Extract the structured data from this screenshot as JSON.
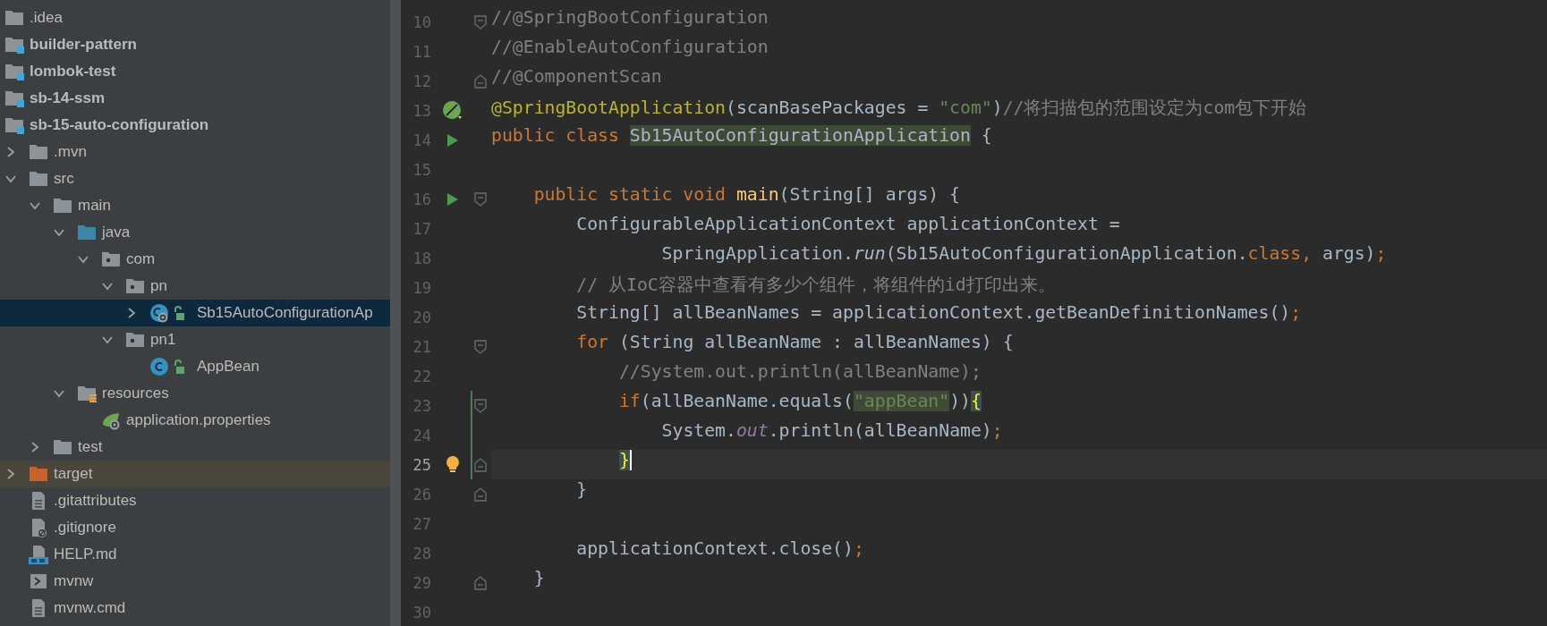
{
  "project_tree": {
    "items": [
      {
        "label": ".idea",
        "kind": "folder",
        "bold": false,
        "selected": false
      },
      {
        "label": "builder-pattern",
        "kind": "module",
        "bold": true,
        "selected": false
      },
      {
        "label": "lombok-test",
        "kind": "module",
        "bold": true,
        "selected": false
      },
      {
        "label": "sb-14-ssm",
        "kind": "module",
        "bold": true,
        "selected": false
      },
      {
        "label": "sb-15-auto-configuration",
        "kind": "module",
        "bold": true,
        "selected": false,
        "children": [
          {
            "label": ".mvn",
            "kind": "folder",
            "bold": false,
            "selected": false,
            "expanded": false
          },
          {
            "label": "src",
            "kind": "folder",
            "bold": false,
            "selected": false,
            "expanded": true,
            "children": [
              {
                "label": "main",
                "kind": "folder",
                "bold": false,
                "selected": false,
                "expanded": true,
                "children": [
                  {
                    "label": "java",
                    "kind": "source-folder",
                    "bold": false,
                    "selected": false,
                    "expanded": true,
                    "children": [
                      {
                        "label": "com",
                        "kind": "package",
                        "bold": false,
                        "selected": false,
                        "expanded": true,
                        "children": [
                          {
                            "label": "pn",
                            "kind": "package",
                            "bold": false,
                            "selected": false,
                            "expanded": true,
                            "children": [
                              {
                                "label": "Sb15AutoConfigurationAp",
                                "kind": "spring-class",
                                "bold": false,
                                "selected": true,
                                "expanded": false
                              }
                            ]
                          },
                          {
                            "label": "pn1",
                            "kind": "package",
                            "bold": false,
                            "selected": false,
                            "expanded": true,
                            "children": [
                              {
                                "label": "AppBean",
                                "kind": "class",
                                "bold": false,
                                "selected": false
                              }
                            ]
                          }
                        ]
                      }
                    ]
                  },
                  {
                    "label": "resources",
                    "kind": "resources",
                    "bold": false,
                    "selected": false,
                    "expanded": true,
                    "children": [
                      {
                        "label": "application.properties",
                        "kind": "properties",
                        "bold": false,
                        "selected": false
                      }
                    ]
                  }
                ]
              },
              {
                "label": "test",
                "kind": "folder",
                "bold": false,
                "selected": false,
                "expanded": false
              }
            ]
          },
          {
            "label": "target",
            "kind": "excluded",
            "bold": false,
            "selected": false,
            "expanded": false
          },
          {
            "label": ".gitattributes",
            "kind": "text-file",
            "bold": false,
            "selected": false
          },
          {
            "label": ".gitignore",
            "kind": "ignore-file",
            "bold": false,
            "selected": false
          },
          {
            "label": "HELP.md",
            "kind": "markdown",
            "bold": false,
            "selected": false
          },
          {
            "label": "mvnw",
            "kind": "script",
            "bold": false,
            "selected": false
          },
          {
            "label": "mvnw.cmd",
            "kind": "text-file",
            "bold": false,
            "selected": false
          }
        ]
      }
    ]
  },
  "editor": {
    "lines": [
      {
        "number": "10",
        "markers": [
          {
            "kind": "fold-start"
          }
        ],
        "changed": false,
        "current": false,
        "segments": [
          {
            "text": "//@SpringBootConfiguration",
            "kind": "comment"
          }
        ]
      },
      {
        "number": "11",
        "changed": false,
        "current": false,
        "segments": [
          {
            "text": "//@EnableAutoConfiguration",
            "kind": "comment"
          }
        ]
      },
      {
        "number": "12",
        "markers": [
          {
            "kind": "fold-end"
          }
        ],
        "changed": false,
        "current": false,
        "segments": [
          {
            "text": "//@ComponentScan",
            "kind": "comment"
          }
        ]
      },
      {
        "number": "13",
        "markers": [
          {
            "kind": "spring"
          }
        ],
        "changed": false,
        "current": false,
        "segments": [
          {
            "text": "@SpringBootApplication",
            "kind": "annotation"
          },
          {
            "text": "(scanBasePackages = ",
            "kind": "plain"
          },
          {
            "text": "\"com\"",
            "kind": "string"
          },
          {
            "text": ")",
            "kind": "plain"
          },
          {
            "text": "//将扫描包的范围设定为com包下开始",
            "kind": "comment"
          }
        ]
      },
      {
        "number": "14",
        "markers": [
          {
            "kind": "run"
          }
        ],
        "changed": false,
        "current": false,
        "segments": [
          {
            "text": "public class ",
            "kind": "keyword"
          },
          {
            "text": "Sb15AutoConfigurationApplication",
            "kind": "usage"
          },
          {
            "text": " {",
            "kind": "plain"
          }
        ]
      },
      {
        "number": "15",
        "changed": false,
        "current": false
      },
      {
        "number": "16",
        "markers": [
          {
            "kind": "run"
          },
          {
            "kind": "fold-start"
          }
        ],
        "changed": false,
        "current": false,
        "segments": [
          {
            "text": "    public static void ",
            "kind": "keyword"
          },
          {
            "text": "main",
            "kind": "method"
          },
          {
            "text": "(String[] args) {",
            "kind": "plain"
          }
        ]
      },
      {
        "number": "17",
        "changed": false,
        "current": false,
        "segments": [
          {
            "text": "        ConfigurableApplicationContext applicationContext =",
            "kind": "plain"
          }
        ]
      },
      {
        "number": "18",
        "changed": false,
        "current": false,
        "segments": [
          {
            "text": "                SpringApplication.",
            "kind": "plain"
          },
          {
            "text": "run",
            "kind": "static-call"
          },
          {
            "text": "(Sb15AutoConfigurationApplication.",
            "kind": "plain"
          },
          {
            "text": "class,",
            "kind": "keyword"
          },
          {
            "text": " args)",
            "kind": "plain"
          },
          {
            "text": ";",
            "kind": "keyword"
          }
        ]
      },
      {
        "number": "19",
        "changed": false,
        "current": false,
        "segments": [
          {
            "text": "        // 从IoC容器中查看有多少个组件，将组件的id打印出来。",
            "kind": "comment"
          }
        ]
      },
      {
        "number": "20",
        "changed": false,
        "current": false,
        "segments": [
          {
            "text": "        String[] allBeanNames = applicationContext.getBeanDefinitionNames()",
            "kind": "plain"
          },
          {
            "text": ";",
            "kind": "keyword"
          }
        ]
      },
      {
        "number": "21",
        "markers": [
          {
            "kind": "fold-start"
          }
        ],
        "changed": false,
        "current": false,
        "segments": [
          {
            "text": "        for",
            "kind": "keyword"
          },
          {
            "text": " (String allBeanName : allBeanNames) {",
            "kind": "plain"
          }
        ]
      },
      {
        "number": "22",
        "changed": false,
        "current": false,
        "segments": [
          {
            "text": "            //System.out.println(allBeanName);",
            "kind": "comment"
          }
        ]
      },
      {
        "number": "23",
        "markers": [
          {
            "kind": "fold-start"
          }
        ],
        "changed": true,
        "current": false,
        "segments": [
          {
            "text": "            if",
            "kind": "keyword"
          },
          {
            "text": "(allBeanName.equals(",
            "kind": "plain"
          },
          {
            "text": "\"appBean\"",
            "kind": "usage-string"
          },
          {
            "text": "))",
            "kind": "plain"
          },
          {
            "text": "{",
            "kind": "brace-match"
          }
        ]
      },
      {
        "number": "24",
        "changed": true,
        "current": false,
        "segments": [
          {
            "text": "                System.",
            "kind": "plain"
          },
          {
            "text": "out",
            "kind": "static-field"
          },
          {
            "text": ".println(allBeanName)",
            "kind": "plain"
          },
          {
            "text": ";",
            "kind": "keyword"
          }
        ]
      },
      {
        "number": "25",
        "markers": [
          {
            "kind": "bulb"
          },
          {
            "kind": "fold-end"
          }
        ],
        "changed": true,
        "current": true,
        "segments": [
          {
            "text": "            }",
            "kind": "brace-match"
          }
        ]
      },
      {
        "number": "26",
        "markers": [
          {
            "kind": "fold-end"
          }
        ],
        "changed": false,
        "current": false,
        "segments": [
          {
            "text": "        }",
            "kind": "plain"
          }
        ]
      },
      {
        "number": "27",
        "changed": false,
        "current": false
      },
      {
        "number": "28",
        "changed": false,
        "current": false,
        "segments": [
          {
            "text": "        applicationContext.close()",
            "kind": "plain"
          },
          {
            "text": ";",
            "kind": "keyword"
          }
        ]
      },
      {
        "number": "29",
        "markers": [
          {
            "kind": "fold-end"
          }
        ],
        "changed": false,
        "current": false,
        "segments": [
          {
            "text": "    }",
            "kind": "plain"
          }
        ]
      },
      {
        "number": "30",
        "changed": false,
        "current": false
      }
    ]
  }
}
